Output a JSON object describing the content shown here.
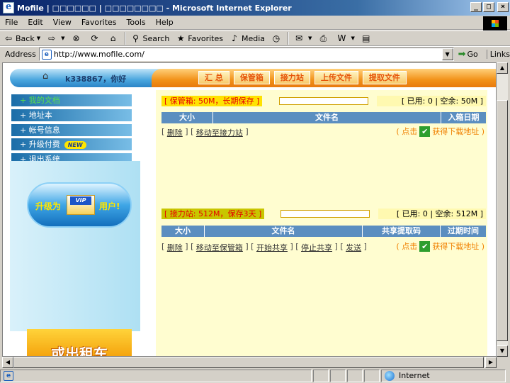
{
  "window": {
    "title": "Mofile | □□□□□□ | □□□□□□□□ - Microsoft Internet Explorer",
    "min": "_",
    "max": "□",
    "close": "×"
  },
  "menu": [
    "File",
    "Edit",
    "View",
    "Favorites",
    "Tools",
    "Help"
  ],
  "toolbar": {
    "back": "Back",
    "search": "Search",
    "favorites": "Favorites",
    "media": "Media"
  },
  "address": {
    "label": "Address",
    "url": "http://www.mofile.com/",
    "go": "Go",
    "links": "Links"
  },
  "nav": {
    "greeting": "k338867，你好",
    "tabs": [
      "汇 总",
      "保管箱",
      "接力站",
      "上传文件",
      "提取文件"
    ]
  },
  "sidebar": {
    "items": [
      {
        "label": "+ 我的文档",
        "active": true
      },
      {
        "label": "+ 地址本"
      },
      {
        "label": "+ 帐号信息"
      },
      {
        "label": "+ 升级付费",
        "badge": "NEW"
      },
      {
        "label": "+ 退出系统"
      }
    ],
    "vip": {
      "text1": "升级为",
      "card": "VIP",
      "text2": "用户!"
    },
    "ad": "或出租车"
  },
  "safebox": {
    "header": "[ 保管箱: 50M，长期保存 ]",
    "usage": "[ 已用: 0 | 空余: 50M ]",
    "used_fraction": 0,
    "columns": [
      "大小",
      "文件名",
      "入箱日期"
    ],
    "actions": [
      "删除",
      "移动至接力站"
    ],
    "download_prefix": "( 点击",
    "download_link": "获得下载地址 )"
  },
  "relay": {
    "header": "[ 接力站: 512M，保存3天 ]",
    "usage": "[ 已用: 0 | 空余: 512M ]",
    "used_fraction": 0,
    "columns": [
      "大小",
      "文件名",
      "共享提取码",
      "过期时间"
    ],
    "actions": [
      "删除",
      "移动至保管箱",
      "开始共享",
      "停止共享",
      "发送"
    ],
    "download_prefix": "( 点击",
    "download_link": "获得下载地址 )"
  },
  "status": {
    "zone": "Internet"
  }
}
